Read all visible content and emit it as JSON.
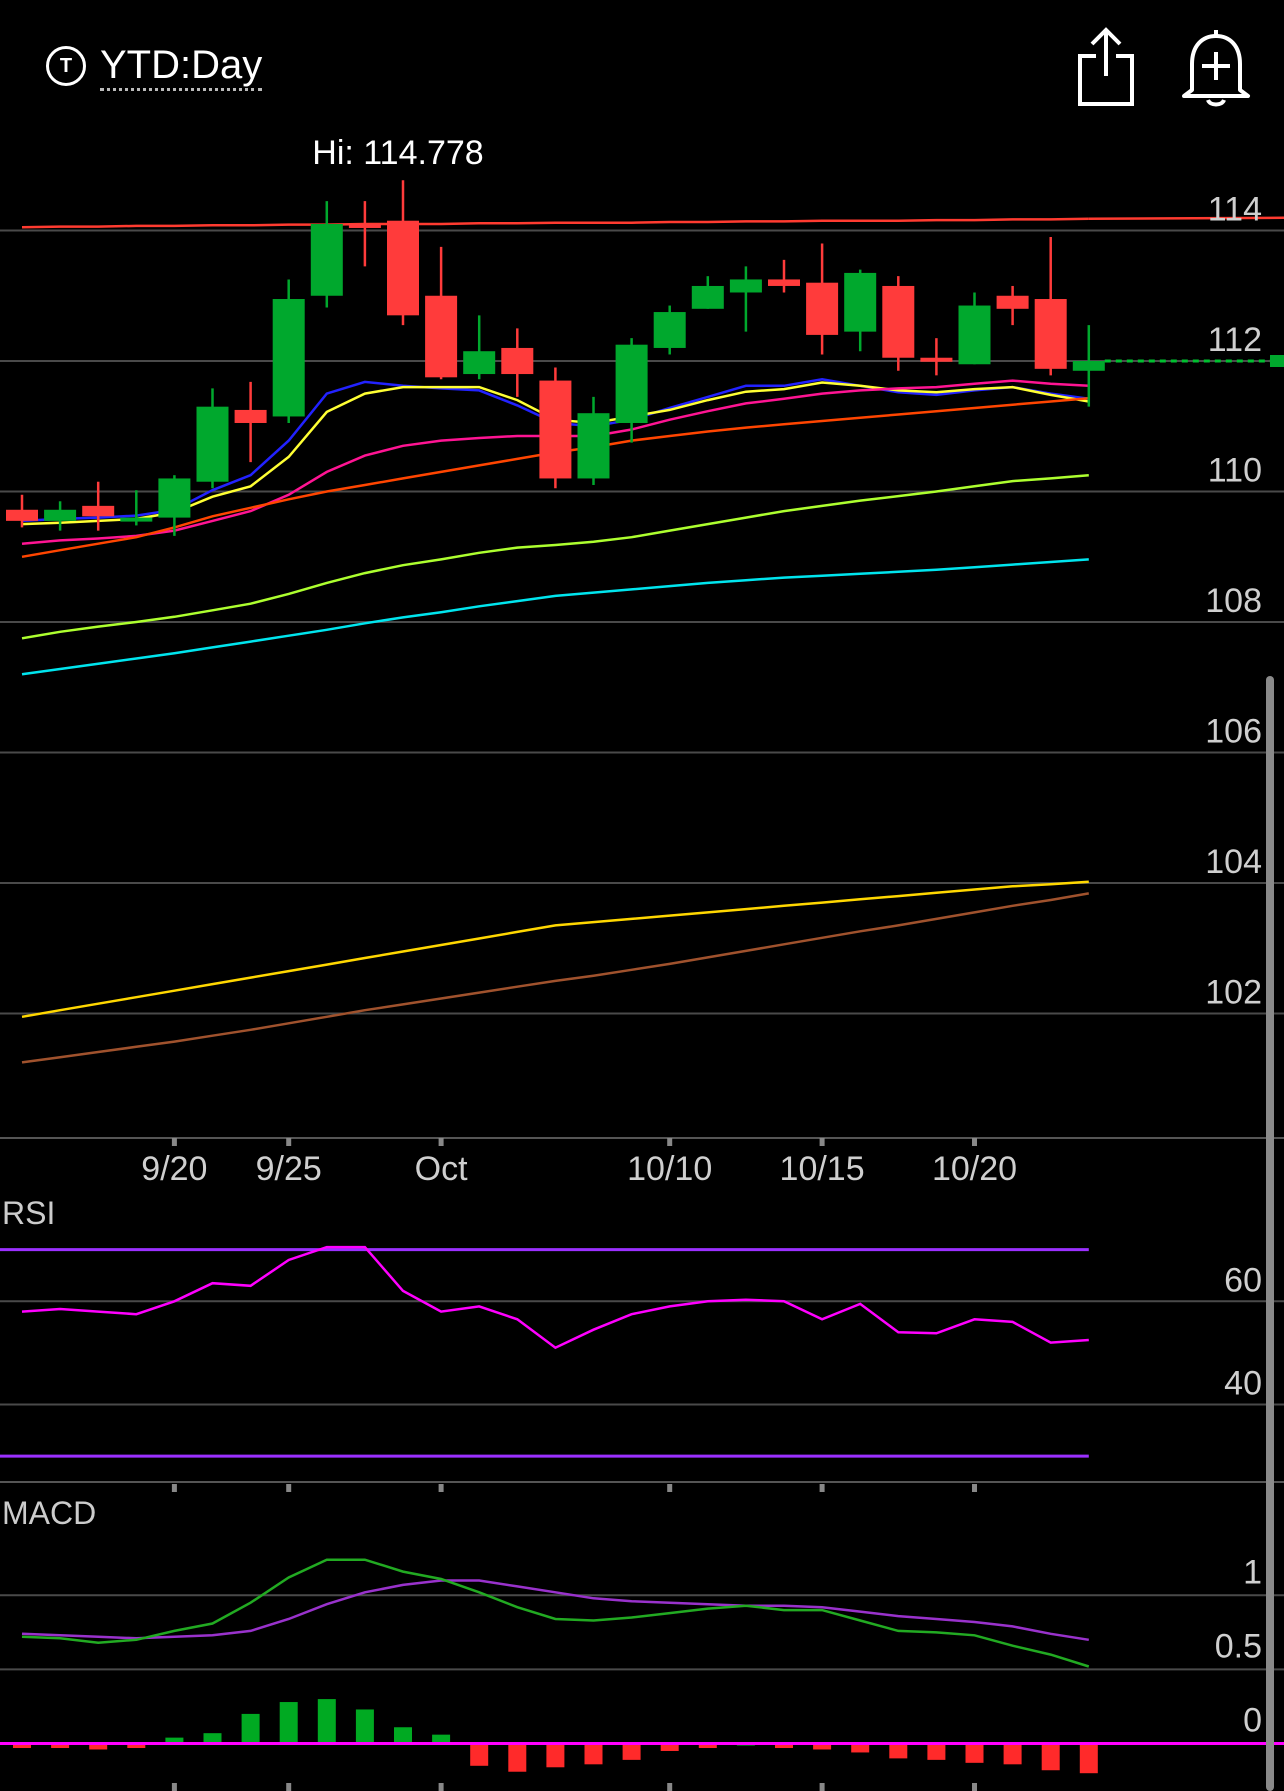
{
  "header": {
    "ticker_icon": "T",
    "range_label": "YTD:Day",
    "share_icon": "share-icon",
    "alert_icon": "bell-plus-icon"
  },
  "chart_data": {
    "type": "candlestick",
    "high_label": "Hi: 114.778",
    "price_axis": {
      "ticks": [
        114,
        112,
        110,
        108,
        106,
        104,
        102
      ],
      "ylim": [
        100,
        116
      ]
    },
    "x_labels": [
      {
        "i": 4,
        "label": "9/20"
      },
      {
        "i": 7,
        "label": "9/25"
      },
      {
        "i": 11,
        "label": "Oct"
      },
      {
        "i": 17,
        "label": "10/10"
      },
      {
        "i": 21,
        "label": "10/15"
      },
      {
        "i": 25,
        "label": "10/20"
      }
    ],
    "candles": [
      {
        "o": 109.72,
        "h": 109.95,
        "l": 109.45,
        "c": 109.55
      },
      {
        "o": 109.55,
        "h": 109.85,
        "l": 109.4,
        "c": 109.72
      },
      {
        "o": 109.78,
        "h": 110.15,
        "l": 109.4,
        "c": 109.62
      },
      {
        "o": 109.55,
        "h": 110.02,
        "l": 109.48,
        "c": 109.6
      },
      {
        "o": 109.6,
        "h": 110.25,
        "l": 109.32,
        "c": 110.2
      },
      {
        "o": 110.15,
        "h": 111.58,
        "l": 110.05,
        "c": 111.3
      },
      {
        "o": 111.25,
        "h": 111.68,
        "l": 110.45,
        "c": 111.05
      },
      {
        "o": 111.15,
        "h": 113.25,
        "l": 111.05,
        "c": 112.95
      },
      {
        "o": 113.0,
        "h": 114.45,
        "l": 112.82,
        "c": 114.1
      },
      {
        "o": 114.1,
        "h": 114.45,
        "l": 113.45,
        "c": 114.05
      },
      {
        "o": 114.15,
        "h": 114.77,
        "l": 112.55,
        "c": 112.7
      },
      {
        "o": 113.0,
        "h": 113.75,
        "l": 111.72,
        "c": 111.75
      },
      {
        "o": 111.8,
        "h": 112.7,
        "l": 111.72,
        "c": 112.15
      },
      {
        "o": 112.2,
        "h": 112.5,
        "l": 111.45,
        "c": 111.8
      },
      {
        "o": 111.7,
        "h": 111.9,
        "l": 110.05,
        "c": 110.2
      },
      {
        "o": 110.2,
        "h": 111.45,
        "l": 110.1,
        "c": 111.2
      },
      {
        "o": 111.05,
        "h": 112.35,
        "l": 110.75,
        "c": 112.25
      },
      {
        "o": 112.2,
        "h": 112.85,
        "l": 112.1,
        "c": 112.75
      },
      {
        "o": 112.8,
        "h": 113.3,
        "l": 112.8,
        "c": 113.15
      },
      {
        "o": 113.05,
        "h": 113.45,
        "l": 112.45,
        "c": 113.25
      },
      {
        "o": 113.25,
        "h": 113.55,
        "l": 113.05,
        "c": 113.15
      },
      {
        "o": 113.2,
        "h": 113.8,
        "l": 112.1,
        "c": 112.4
      },
      {
        "o": 112.45,
        "h": 113.4,
        "l": 112.15,
        "c": 113.35
      },
      {
        "o": 113.15,
        "h": 113.3,
        "l": 111.85,
        "c": 112.05
      },
      {
        "o": 112.05,
        "h": 112.35,
        "l": 111.78,
        "c": 112.0
      },
      {
        "o": 111.95,
        "h": 113.05,
        "l": 111.95,
        "c": 112.85
      },
      {
        "o": 113.0,
        "h": 113.15,
        "l": 112.55,
        "c": 112.8
      },
      {
        "o": 112.95,
        "h": 113.9,
        "l": 111.78,
        "c": 111.88
      },
      {
        "o": 111.85,
        "h": 112.55,
        "l": 111.3,
        "c": 112.0
      }
    ],
    "overlays": [
      {
        "color": "#ff3b30",
        "values": [
          114.05,
          114.06,
          114.06,
          114.07,
          114.07,
          114.08,
          114.08,
          114.09,
          114.09,
          114.1,
          114.1,
          114.1,
          114.11,
          114.11,
          114.12,
          114.12,
          114.12,
          114.13,
          114.13,
          114.14,
          114.14,
          114.15,
          114.15,
          114.15,
          114.16,
          114.16,
          114.17,
          114.17,
          114.18
        ]
      },
      {
        "color": "#2222ff",
        "values": [
          109.55,
          109.58,
          109.6,
          109.63,
          109.72,
          110.02,
          110.25,
          110.78,
          111.5,
          111.68,
          111.62,
          111.58,
          111.55,
          111.32,
          111.05,
          111.0,
          111.1,
          111.28,
          111.45,
          111.62,
          111.62,
          111.72,
          111.62,
          111.52,
          111.48,
          111.55,
          111.6,
          111.5,
          111.42
        ]
      },
      {
        "color": "#ffff33",
        "values": [
          109.5,
          109.52,
          109.55,
          109.58,
          109.68,
          109.92,
          110.08,
          110.53,
          111.22,
          111.5,
          111.6,
          111.6,
          111.6,
          111.4,
          111.1,
          111.05,
          111.15,
          111.25,
          111.4,
          111.53,
          111.57,
          111.67,
          111.62,
          111.55,
          111.52,
          111.57,
          111.6,
          111.48,
          111.38
        ]
      },
      {
        "color": "#ff1493",
        "values": [
          109.2,
          109.25,
          109.28,
          109.32,
          109.4,
          109.55,
          109.7,
          109.95,
          110.3,
          110.55,
          110.7,
          110.78,
          110.82,
          110.85,
          110.85,
          110.85,
          110.95,
          111.1,
          111.23,
          111.35,
          111.42,
          111.5,
          111.55,
          111.58,
          111.6,
          111.65,
          111.7,
          111.65,
          111.62
        ]
      },
      {
        "color": "#ff4500",
        "values": [
          109.0,
          109.1,
          109.2,
          109.3,
          109.45,
          109.62,
          109.75,
          109.88,
          110.0,
          110.1,
          110.2,
          110.3,
          110.4,
          110.5,
          110.6,
          110.68,
          110.78,
          110.85,
          110.92,
          110.98,
          111.03,
          111.08,
          111.13,
          111.18,
          111.23,
          111.28,
          111.33,
          111.38,
          111.43
        ]
      },
      {
        "color": "#adff2f",
        "values": [
          107.75,
          107.85,
          107.93,
          108.0,
          108.08,
          108.18,
          108.28,
          108.43,
          108.6,
          108.75,
          108.87,
          108.96,
          109.06,
          109.14,
          109.18,
          109.23,
          109.3,
          109.4,
          109.5,
          109.6,
          109.7,
          109.78,
          109.86,
          109.93,
          110.0,
          110.08,
          110.16,
          110.2,
          110.25
        ]
      },
      {
        "color": "#00e5ee",
        "values": [
          107.2,
          107.28,
          107.36,
          107.44,
          107.52,
          107.61,
          107.7,
          107.79,
          107.88,
          107.98,
          108.07,
          108.15,
          108.24,
          108.32,
          108.4,
          108.45,
          108.5,
          108.55,
          108.6,
          108.64,
          108.68,
          108.71,
          108.74,
          108.77,
          108.8,
          108.84,
          108.88,
          108.92,
          108.96
        ]
      },
      {
        "color": "#ffd700",
        "values": [
          101.95,
          102.05,
          102.15,
          102.25,
          102.35,
          102.45,
          102.55,
          102.65,
          102.75,
          102.85,
          102.95,
          103.05,
          103.15,
          103.25,
          103.35,
          103.4,
          103.45,
          103.5,
          103.55,
          103.6,
          103.65,
          103.7,
          103.75,
          103.8,
          103.85,
          103.9,
          103.95,
          103.98,
          104.02
        ]
      },
      {
        "color": "#a0522d",
        "values": [
          101.25,
          101.33,
          101.41,
          101.49,
          101.57,
          101.66,
          101.75,
          101.85,
          101.95,
          102.05,
          102.14,
          102.23,
          102.32,
          102.41,
          102.5,
          102.58,
          102.67,
          102.76,
          102.86,
          102.96,
          103.06,
          103.16,
          103.26,
          103.35,
          103.45,
          103.55,
          103.65,
          103.74,
          103.84
        ]
      }
    ],
    "last_price": 112.0,
    "rsi": {
      "label": "RSI",
      "ticks": [
        60,
        40
      ],
      "range": [
        25,
        80
      ],
      "upper_band": 70,
      "lower_band": 30,
      "line_color": "#ff00ff",
      "band_color": "#9b30ff",
      "values": [
        58.0,
        58.5,
        58.0,
        57.5,
        60.0,
        63.5,
        63.0,
        68.0,
        70.5,
        70.5,
        62.0,
        58.0,
        59.0,
        56.5,
        51.0,
        54.5,
        57.5,
        59.0,
        60.0,
        60.3,
        60.0,
        56.5,
        59.5,
        54.0,
        53.8,
        56.5,
        56.0,
        52.0,
        52.5
      ]
    },
    "macd": {
      "label": "MACD",
      "ticks": [
        1,
        0.5,
        0
      ],
      "range": [
        -0.32,
        1.4
      ],
      "macd_color": "#22aa22",
      "signal_color": "#9932cc",
      "hist_pos_color": "#00aa22",
      "hist_neg_color": "#ff2a2a",
      "zero_color": "#ff00ff",
      "macd_values": [
        0.72,
        0.71,
        0.68,
        0.7,
        0.76,
        0.81,
        0.95,
        1.12,
        1.24,
        1.24,
        1.16,
        1.11,
        1.02,
        0.92,
        0.84,
        0.83,
        0.85,
        0.88,
        0.91,
        0.93,
        0.9,
        0.9,
        0.83,
        0.76,
        0.75,
        0.73,
        0.66,
        0.6,
        0.52
      ],
      "signal_values": [
        0.74,
        0.73,
        0.72,
        0.71,
        0.72,
        0.73,
        0.76,
        0.84,
        0.94,
        1.02,
        1.07,
        1.1,
        1.1,
        1.06,
        1.02,
        0.98,
        0.96,
        0.95,
        0.94,
        0.93,
        0.93,
        0.92,
        0.89,
        0.86,
        0.84,
        0.82,
        0.79,
        0.74,
        0.7
      ],
      "hist_values": [
        -0.03,
        -0.03,
        -0.04,
        -0.03,
        0.04,
        0.07,
        0.2,
        0.28,
        0.3,
        0.23,
        0.11,
        0.06,
        -0.15,
        -0.19,
        -0.16,
        -0.14,
        -0.11,
        -0.05,
        -0.03,
        0.0,
        -0.03,
        -0.04,
        -0.06,
        -0.1,
        -0.11,
        -0.13,
        -0.14,
        -0.18,
        -0.2
      ]
    }
  }
}
